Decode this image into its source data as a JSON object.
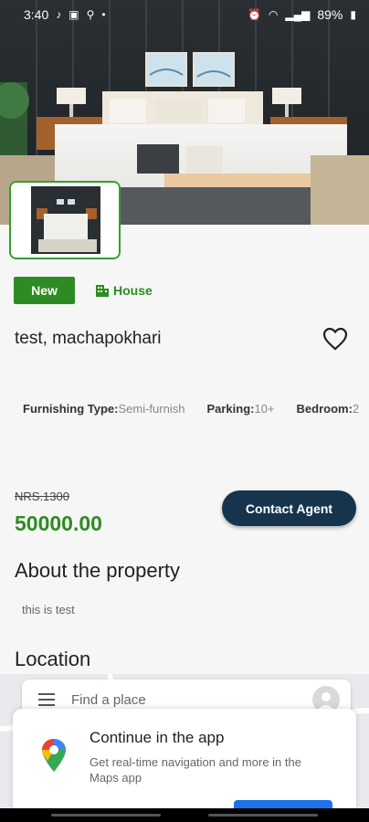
{
  "status_bar": {
    "time": "3:40",
    "battery": "89%"
  },
  "listing": {
    "badge_new": "New",
    "type_label": "House",
    "title": "test, machapokhari",
    "features": [
      {
        "key": "Furnishing Type:",
        "value": "Semi-furnish"
      },
      {
        "key": "Parking:",
        "value": "10+"
      },
      {
        "key": "Bedroom:",
        "value": "2"
      }
    ],
    "old_price": "NRS.1300",
    "price": "50000.00",
    "contact_label": "Contact  Agent",
    "about_heading": "About the property",
    "about_text": "this is test",
    "location_heading": "Location"
  },
  "map": {
    "search_placeholder": "Find a place",
    "sheet_title": "Continue in the app",
    "sheet_subtitle": "Get real-time navigation and more in the Maps app"
  },
  "colors": {
    "accent_green": "#2e8b23",
    "contact_button": "#17344e",
    "maps_blue": "#1a73e8"
  }
}
